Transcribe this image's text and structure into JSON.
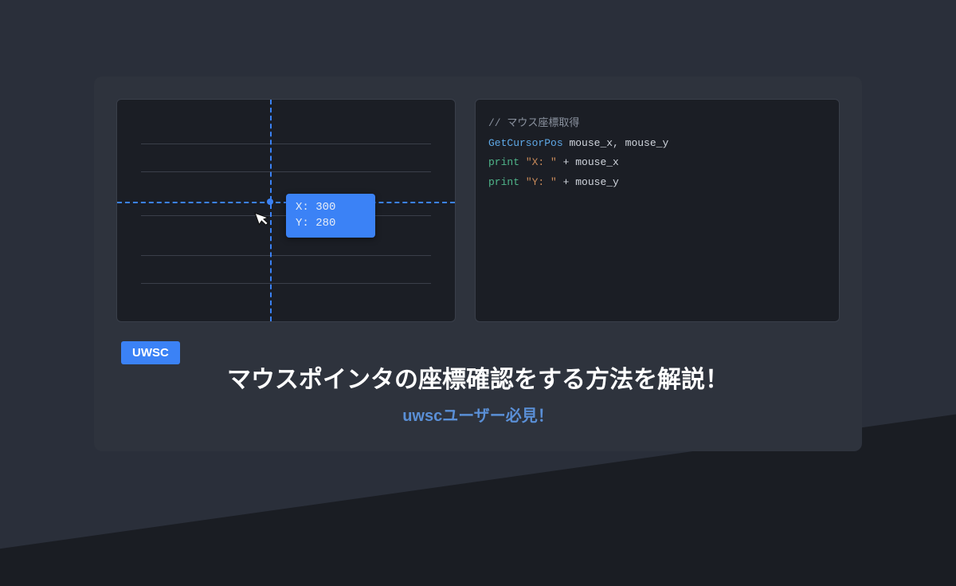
{
  "badge": "UWSC",
  "title": "マウスポインタの座標確認をする方法を解説！",
  "subtitle": "uwscユーザー必見！",
  "mouse": {
    "x_label": "X: 300",
    "y_label": "Y: 280"
  },
  "code": {
    "comment": "// マウス座標取得",
    "line1_func": "GetCursorPos",
    "line1_args": "mouse_x, mouse_y",
    "line2_key": "print",
    "line2_str": "\"X: \"",
    "line2_rest": " + mouse_x",
    "line3_key": "print",
    "line3_str": "\"Y: \"",
    "line3_rest": " + mouse_y"
  }
}
